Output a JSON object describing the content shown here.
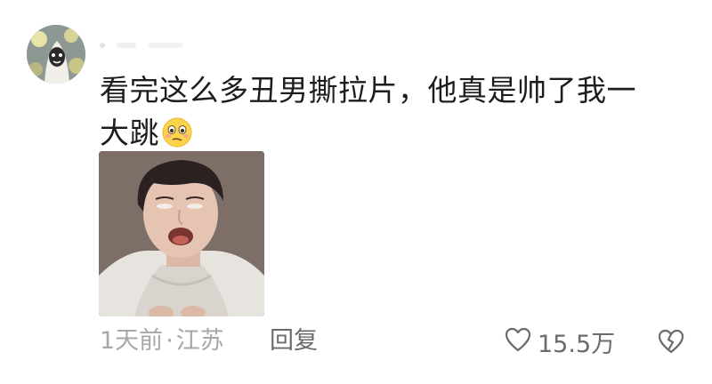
{
  "comment": {
    "text_line1": "看完这么多丑男撕拉片，他真是帅了我一",
    "text_line2": "大跳",
    "time": "1天前",
    "separator": "·",
    "location": "江苏",
    "reply_label": "回复",
    "like_count": "15.5万"
  },
  "icons": {
    "like": "heart-outline-icon",
    "dislike": "broken-heart-icon",
    "emoji": "woozy-face-emoji-icon"
  },
  "colors": {
    "text": "#1d1d1f",
    "meta": "#a7a7a7",
    "action": "#6b6b6b"
  }
}
